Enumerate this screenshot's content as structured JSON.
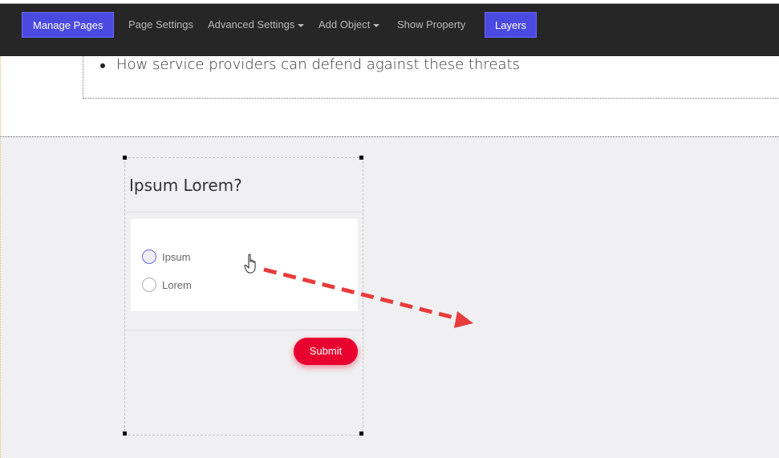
{
  "toolbar": {
    "manage_pages": "Manage Pages",
    "page_settings": "Page Settings",
    "advanced_settings": "Advanced Settings",
    "add_object": "Add Object",
    "show_property": "Show Property",
    "layers": "Layers"
  },
  "content": {
    "bullet_item": "How service providers can defend against these threats"
  },
  "form": {
    "question": "Ipsum Lorem?",
    "options": [
      "Ipsum",
      "Lorem"
    ],
    "submit_label": "Submit"
  },
  "colors": {
    "toolbar_bg": "#262626",
    "primary_button": "#4a4ae0",
    "submit_button": "#e8002e",
    "annotation_arrow": "#e83c3c"
  },
  "icons": {
    "cursor": "hand-pointer-icon",
    "annotation": "dashed-arrow-icon"
  }
}
